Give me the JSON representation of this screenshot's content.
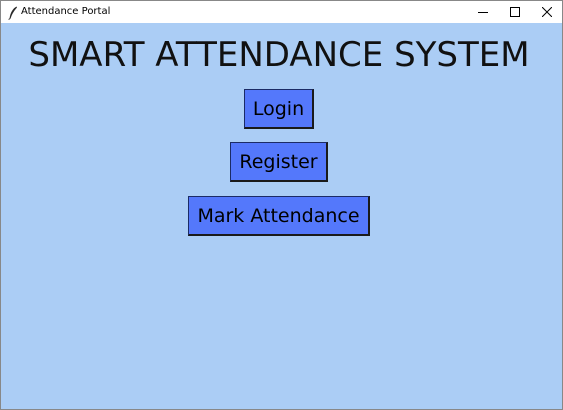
{
  "window": {
    "title": "Attendance Portal",
    "icons": {
      "app": "feather-icon",
      "minimize": "minimize-icon",
      "maximize": "maximize-icon",
      "close": "close-icon"
    }
  },
  "main": {
    "heading": "SMART ATTENDANCE SYSTEM",
    "buttons": {
      "login": "Login",
      "register": "Register",
      "mark_attendance": "Mark Attendance"
    }
  },
  "colors": {
    "background": "#abcdf5",
    "button": "#5478fb",
    "text": "#111111"
  }
}
